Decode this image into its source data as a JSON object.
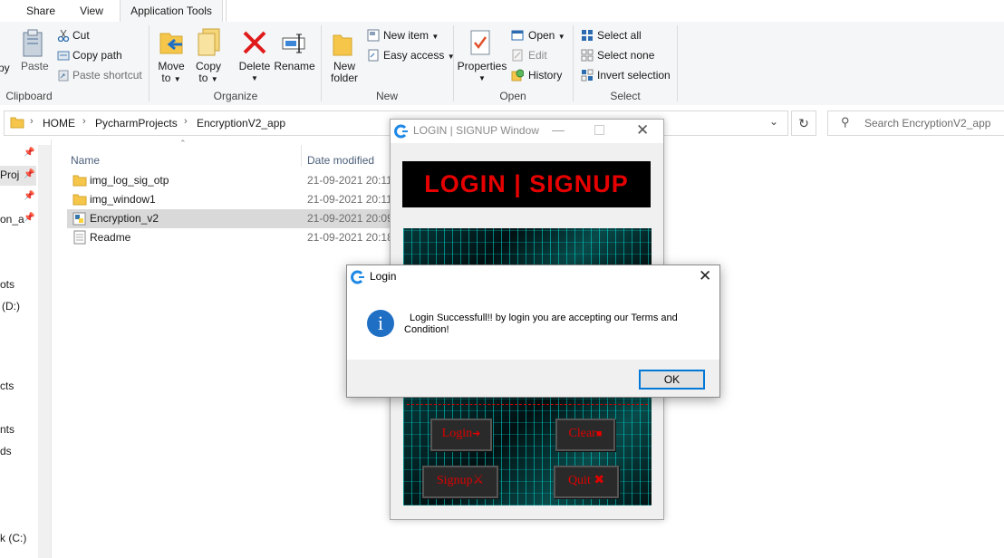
{
  "ribbon_tabs": [
    "Share",
    "View",
    "Application Tools"
  ],
  "clipboard": {
    "copy_partial": "py",
    "paste": "Paste",
    "cut": "Cut",
    "copy_path": "Copy path",
    "paste_shortcut": "Paste shortcut",
    "label": "Clipboard"
  },
  "organize": {
    "move_to": [
      "Move",
      "to"
    ],
    "copy_to": [
      "Copy",
      "to"
    ],
    "delete": "Delete",
    "rename": "Rename",
    "label": "Organize"
  },
  "new_group": {
    "new_folder": [
      "New",
      "folder"
    ],
    "new_item": "New item",
    "easy_access": "Easy access",
    "label": "New"
  },
  "open_group": {
    "properties": "Properties",
    "open": "Open",
    "edit": "Edit",
    "history": "History",
    "label": "Open"
  },
  "select_group": {
    "select_all": "Select all",
    "select_none": "Select none",
    "invert_selection": "Invert selection",
    "label": "Select"
  },
  "address": {
    "breadcrumb": [
      "HOME",
      "PycharmProjects",
      "EncryptionV2_app"
    ],
    "search_placeholder": "Search EncryptionV2_app"
  },
  "nav_pane": [
    "Proj",
    "on_a",
    "ots",
    "(D:)",
    "cts",
    "nts",
    "ds",
    "k (C:)"
  ],
  "columns": {
    "name": "Name",
    "date": "Date modified"
  },
  "files": [
    {
      "name": "img_log_sig_otp",
      "date": "21-09-2021 20:11",
      "type": "folder"
    },
    {
      "name": "img_window1",
      "date": "21-09-2021 20:11",
      "type": "folder"
    },
    {
      "name": "Encryption_v2",
      "date": "21-09-2021 20:09",
      "type": "python"
    },
    {
      "name": "Readme",
      "date": "21-09-2021 20:18",
      "type": "text"
    }
  ],
  "tk_window": {
    "title": "LOGIN | SIGNUP Window",
    "banner": "LOGIN  |  SIGNUP",
    "login_btn": "Login",
    "clear_btn": "Clear",
    "signup_btn": "Signup",
    "quit_btn": "Quit"
  },
  "dialog": {
    "title": "Login",
    "message_line1": "Login Successfull!!  by login you are accepting our Terms and",
    "message_line2": "Condition!",
    "ok": "OK"
  },
  "colors": {
    "accent": "#0078d7",
    "banner_red": "#e60000",
    "selected_row": "#d9d9d9"
  }
}
